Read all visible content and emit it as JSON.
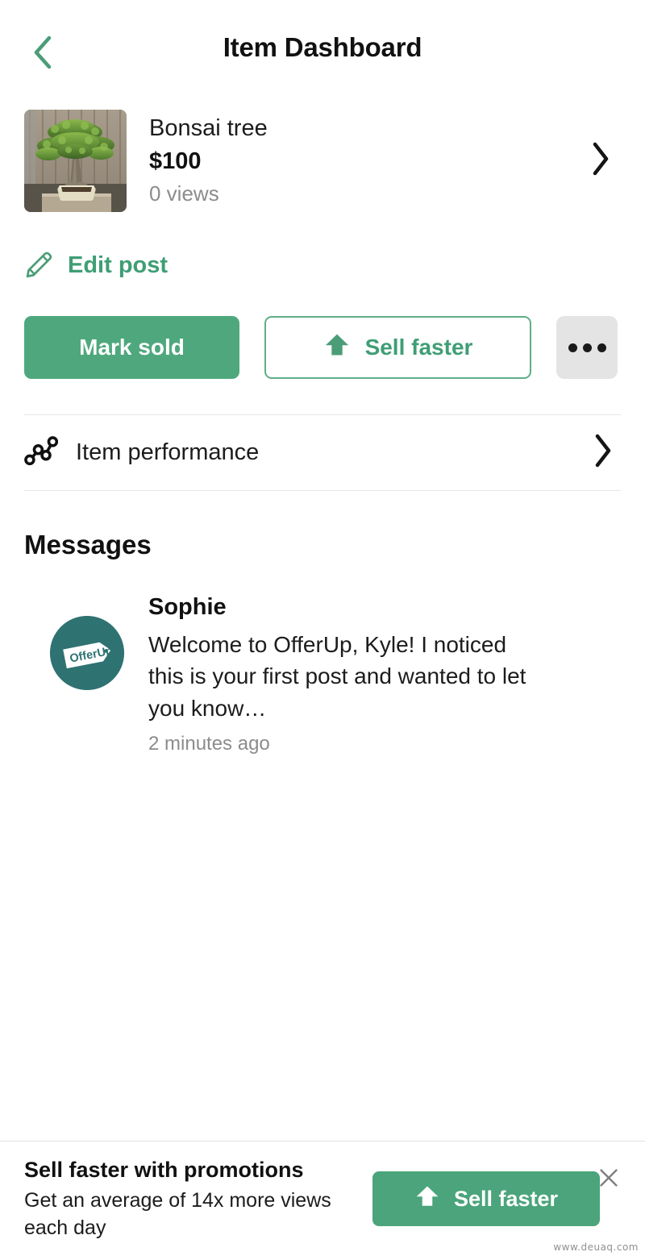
{
  "header": {
    "title": "Item Dashboard",
    "back_icon": "chevron-left-icon"
  },
  "item": {
    "title": "Bonsai tree",
    "price": "$100",
    "views": "0 views",
    "thumbnail_alt": "bonsai-tree-photo",
    "chevron_icon": "chevron-right-icon"
  },
  "edit": {
    "label": "Edit post",
    "icon": "pencil-icon"
  },
  "actions": {
    "mark_sold": "Mark sold",
    "sell_faster": "Sell faster",
    "sell_faster_icon": "arrow-up-icon",
    "more_icon": "ellipsis-icon"
  },
  "performance": {
    "label": "Item performance",
    "icon": "graph-nodes-icon",
    "chevron_icon": "chevron-right-icon"
  },
  "messages": {
    "heading": "Messages",
    "items": [
      {
        "name": "Sophie",
        "preview": "Welcome to OfferUp, Kyle! I noticed this is your first post and wanted to let you know…",
        "time": "2 minutes ago",
        "avatar_label": "OfferUp"
      }
    ]
  },
  "promo": {
    "title": "Sell faster with promotions",
    "subtitle": "Get an average of 14x more views each day",
    "button_label": "Sell faster",
    "button_icon": "arrow-up-icon",
    "close_icon": "close-icon"
  },
  "watermark": "www.deuaq.com",
  "colors": {
    "brand_green": "#4fa87d",
    "brand_green_text": "#3f9e75",
    "promo_green": "#4ba47b",
    "avatar_teal": "#2f7272",
    "muted_text": "#8c8c8c",
    "more_button_bg": "#e4e4e4",
    "divider": "#e6e6e6"
  }
}
